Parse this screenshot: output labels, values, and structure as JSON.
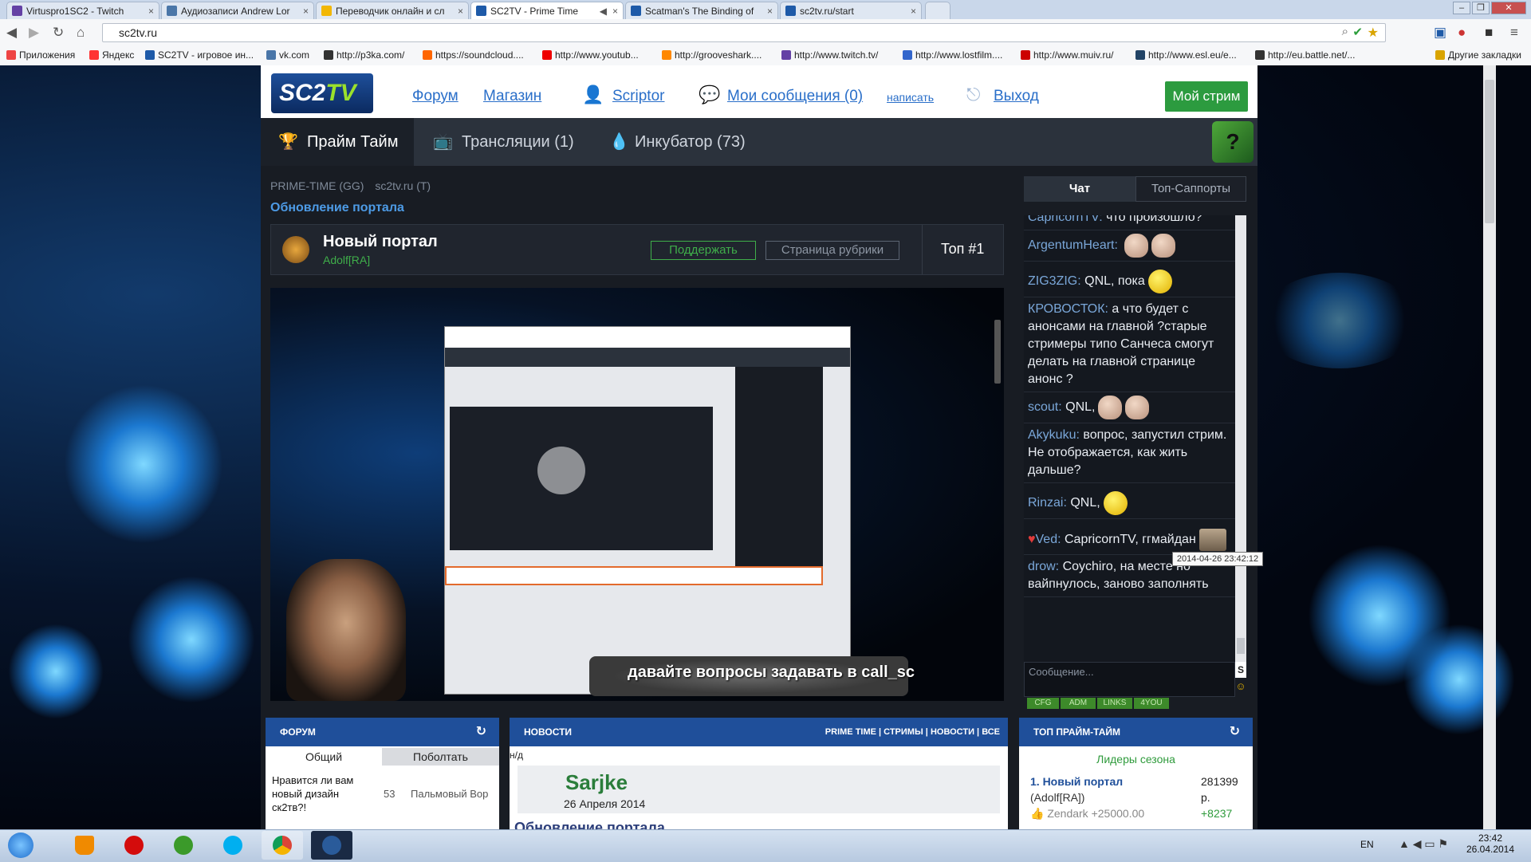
{
  "browser": {
    "tabs": [
      {
        "title": "Virtuspro1SC2 - Twitch",
        "close": "×",
        "active": false,
        "icon_color": "#6441a5"
      },
      {
        "title": "Аудиозаписи Andrew Lor",
        "close": "×",
        "active": false,
        "icon_color": "#4a76a8"
      },
      {
        "title": "Переводчик онлайн и сл",
        "close": "×",
        "active": false,
        "icon_color": "#f2b705"
      },
      {
        "title": "SC2TV - Prime Time",
        "close": "×",
        "active": true,
        "icon_color": "#1e5aa8"
      },
      {
        "title": "Scatman's The Binding of",
        "close": "×",
        "active": false,
        "icon_color": "#1e5aa8"
      },
      {
        "title": "sc2tv.ru/start",
        "close": "×",
        "active": false,
        "icon_color": "#1e5aa8"
      }
    ],
    "url": "sc2tv.ru",
    "window_buttons": [
      "–",
      "❐",
      "✕"
    ],
    "bookmarks": [
      {
        "label": "Приложения",
        "color": "#e44"
      },
      {
        "label": "Яндекс",
        "color": "#f33"
      },
      {
        "label": "SC2TV - игровое ин...",
        "color": "#1e5aa8"
      },
      {
        "label": "vk.com",
        "color": "#4a76a8"
      },
      {
        "label": "http://p3ka.com/",
        "color": "#333"
      },
      {
        "label": "https://soundcloud....",
        "color": "#f60"
      },
      {
        "label": "http://www.youtub...",
        "color": "#e00"
      },
      {
        "label": "http://grooveshark....",
        "color": "#f80"
      },
      {
        "label": "http://www.twitch.tv/",
        "color": "#6441a5"
      },
      {
        "label": "http://www.lostfilm....",
        "color": "#36c"
      },
      {
        "label": "http://www.muiv.ru/",
        "color": "#c00"
      },
      {
        "label": "http://www.esl.eu/e...",
        "color": "#246"
      },
      {
        "label": "http://eu.battle.net/...",
        "color": "#333"
      },
      {
        "label": "Другие закладки",
        "color": "#d9a400"
      }
    ]
  },
  "site": {
    "logo_main": "SC2",
    "logo_sub": "TV",
    "header_links": {
      "forum": "Форум",
      "shop": "Магазин",
      "user": "Scriptor",
      "messages": "Мои сообщения (0)",
      "write": "написать",
      "logout": "Выход"
    },
    "my_stream": "Мой стрим",
    "nav": {
      "primetime": "Прайм Тайм",
      "broadcasts": "Трансляции (1)",
      "incubator": "Инкубатор (73)"
    },
    "breadcrumbs": [
      "PRIME-TIME (GG)",
      "sc2tv.ru (T)"
    ],
    "section_title": "Обновление портала",
    "streamer": {
      "title": "Новый портал",
      "author": "Adolf[RA]",
      "support_button": "Поддержать",
      "rubric_button": "Страница рубрики",
      "rank": "Топ #1"
    },
    "video_caption": "давайте вопросы задавать в call_sc",
    "chat": {
      "tab_chat": "Чат",
      "tab_supporters": "Топ-Саппорты",
      "messages": [
        {
          "nick": "CapricornTV:",
          "text": "что произошло?"
        },
        {
          "nick": "ArgentumHeart:",
          "text": ""
        },
        {
          "nick": "ZIG3ZIG:",
          "text": "QNL, пока"
        },
        {
          "nick": "КРОВОСТОК:",
          "text": "а что будет с анонсами на главной ?старые стримеры типо Санчеса смогут делать на главной странице анонс ?"
        },
        {
          "nick": "scout:",
          "text": "QNL,"
        },
        {
          "nick": "Akykuku:",
          "text": "вопрос, запустил стрим. Не отображается, как жить дальше?"
        },
        {
          "nick": "Rinzai:",
          "text": "QNL,"
        },
        {
          "nick": "Ved:",
          "text": "CapricornTV, ггмайдан"
        },
        {
          "nick": "drow:",
          "text": "Coychiro, на месте но вайпнулось, заново заполнять"
        }
      ],
      "input_placeholder": "Сообщение...",
      "send_label": "S",
      "buttons": [
        "CFG",
        "ADM",
        "LINKS",
        "4YOU"
      ],
      "tooltip_time": "2014-04-26 23:42:12"
    },
    "forum_block": {
      "title": "ФОРУМ",
      "tab_general": "Общий",
      "tab_talk": "Поболтать",
      "topic": "Нравится ли вам новый дизайн ск2тв?!",
      "replies": "53",
      "author": "Пальмовый Вор"
    },
    "news_block": {
      "title": "НОВОСТИ",
      "filters": [
        "PRIME TIME",
        "СТРИМЫ",
        "НОВОСТИ",
        "ВСЕ"
      ],
      "nd": "н/д",
      "news_author": "Sarjke",
      "news_date": "26 Апреля 2014",
      "news_title": "Обновление портала"
    },
    "top_block": {
      "title": "ТОП ПРАЙМ-ТАЙМ",
      "subtitle": "Лидеры сезона",
      "item_title": "1. Новый портал",
      "item_author": "(Adolf[RA])",
      "item_donor": "Zendark +25000.00",
      "item_amount": "281399",
      "item_currency": "р.",
      "item_plus": "+8237"
    }
  },
  "taskbar": {
    "lang": "EN",
    "time": "23:42",
    "date": "26.04.2014"
  }
}
